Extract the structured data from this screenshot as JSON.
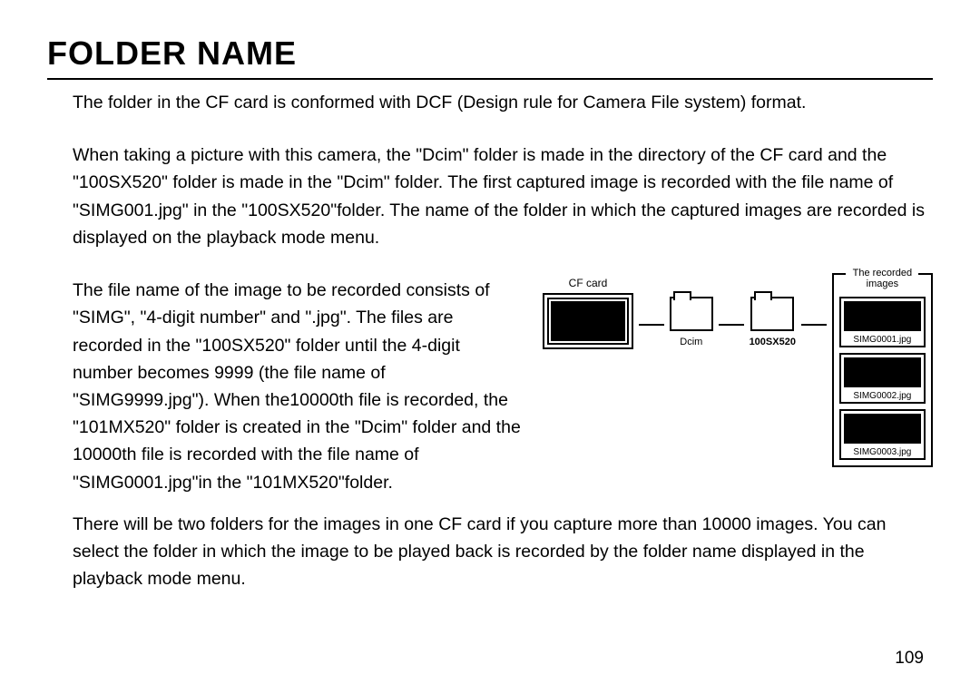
{
  "title": "FOLDER NAME",
  "para1": "The folder in the CF card is conformed with DCF (Design rule for Camera File system) format.",
  "para2": "When taking a picture with this camera, the \"Dcim\" folder is made in the directory of the CF card and the \"100SX520\" folder is made in the \"Dcim\" folder. The first captured image is recorded with the file name of \"SIMG001.jpg\" in the \"100SX520\"folder. The name of the folder in which the captured images are recorded is displayed on the playback mode menu.",
  "para3": "The file name of the image to be recorded consists of \"SIMG\", \"4-digit number\" and \".jpg\". The files are recorded in the \"100SX520\" folder until the 4-digit number becomes 9999 (the file name of \"SIMG9999.jpg\"). When the10000th file is recorded, the \"101MX520\" folder is created in the \"Dcim\" folder and the 10000th file is recorded with the file name of \"SIMG0001.jpg\"in the \"101MX520\"folder.",
  "para4": "There will be two folders for the images in one CF card if you capture more than 10000 images. You can select the folder in which the image to be played back is recorded by the folder name displayed in the playback mode menu.",
  "pagenum": "109",
  "diagram": {
    "cf_label": "CF card",
    "folder1_label": "Dcim",
    "folder2_label": "100SX520",
    "images_title": "The recorded images",
    "images": [
      "SIMG0001.jpg",
      "SIMG0002.jpg",
      "SIMG0003.jpg"
    ]
  }
}
